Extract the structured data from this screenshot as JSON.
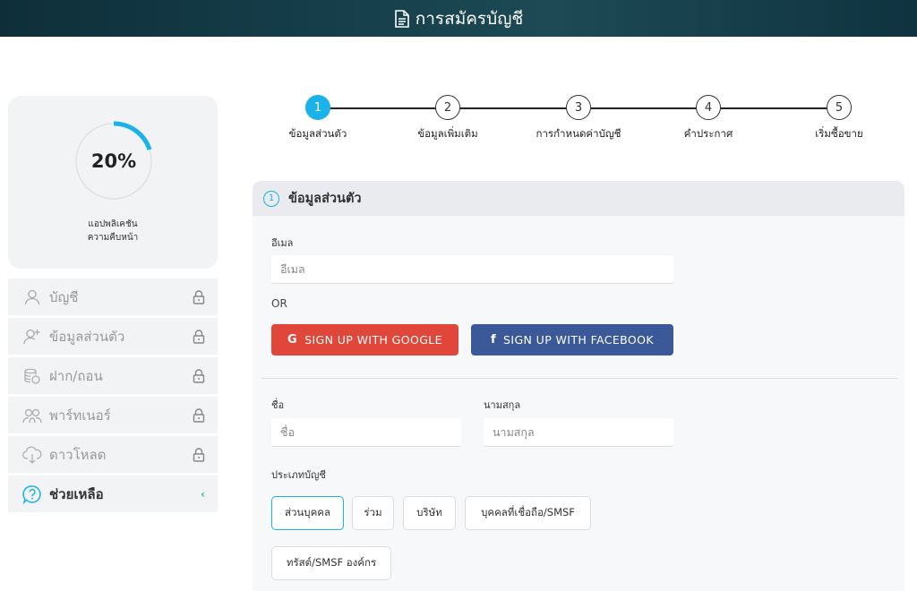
{
  "header": {
    "title": "การสมัครบัญชี",
    "icon": "document-icon"
  },
  "progress": {
    "percent_label": "20%",
    "fraction": 0.2,
    "label_line1": "แอปพลิเคชัน",
    "label_line2": "ความคืบหน้า",
    "accent": "#1ab2e8"
  },
  "sidebar": {
    "items": [
      {
        "label": "บัญชี",
        "icon": "user-icon",
        "locked": true
      },
      {
        "label": "ข้อมูลส่วนตัว",
        "icon": "user-add-icon",
        "locked": true
      },
      {
        "label": "ฝาก/ถอน",
        "icon": "coins-icon",
        "locked": true
      },
      {
        "label": "พาร์ทเนอร์",
        "icon": "partners-icon",
        "locked": true
      },
      {
        "label": "ดาวโหลด",
        "icon": "cloud-download-icon",
        "locked": true
      },
      {
        "label": "ช่วยเหลือ",
        "icon": "help-icon",
        "chevron": "‹"
      }
    ]
  },
  "stepper": {
    "steps": [
      {
        "num": "1",
        "label": "ข้อมูลส่วนตัว",
        "active": true
      },
      {
        "num": "2",
        "label": "ข้อมูลเพิ่มเติม"
      },
      {
        "num": "3",
        "label": "การกำหนดค่าบัญชี"
      },
      {
        "num": "4",
        "label": "คำประกาศ"
      },
      {
        "num": "5",
        "label": "เริ่มซื้อขาย"
      }
    ]
  },
  "form": {
    "section_num": "1",
    "section_title": "ข้อมูลส่วนตัว",
    "email_label": "อีเมล",
    "email_placeholder": "อีเมล",
    "or_text": "OR",
    "google_label": "SIGN UP WITH GOOGLE",
    "facebook_label": "SIGN UP WITH FACEBOOK",
    "first_name_label": "ชื่อ",
    "first_name_placeholder": "ชื่อ",
    "last_name_label": "นามสกุล",
    "last_name_placeholder": "นามสกุล",
    "account_type_label": "ประเภทบัญชี",
    "account_types": [
      "ส่วนบุคคล",
      "ร่วม",
      "บริษัท",
      "บุคคลที่เชื่อถือ/SMSF",
      "ทรัสต์/SMSF องค์กร"
    ],
    "selected_type": "ส่วนบุคคล",
    "colors": {
      "google": "#e0463a",
      "facebook": "#3b5998"
    }
  }
}
